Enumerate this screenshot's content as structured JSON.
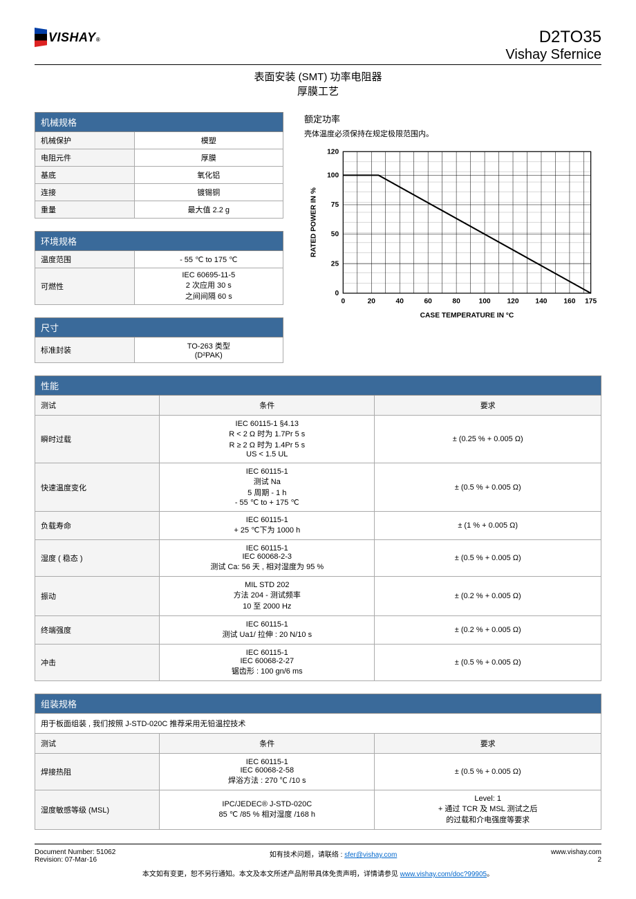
{
  "header": {
    "logo_text": "VISHAY",
    "logo_mark": "®",
    "product_code": "D2TO35",
    "brand": "Vishay Sfernice",
    "title_line1": "表面安装 (SMT) 功率电阻器",
    "title_line2": "厚膜工艺"
  },
  "mech": {
    "title": "机械规格",
    "rows": [
      {
        "label": "机械保护",
        "value": "模塑"
      },
      {
        "label": "电阻元件",
        "value": "厚膜"
      },
      {
        "label": "基底",
        "value": "氧化铝"
      },
      {
        "label": "连接",
        "value": "镀锡铜"
      },
      {
        "label": "重量",
        "value": "最大值 2.2 g"
      }
    ]
  },
  "env": {
    "title": "环境规格",
    "rows": [
      {
        "label": "温度范围",
        "value": "- 55 ℃ to 175 ℃"
      },
      {
        "label": "可燃性",
        "value": "IEC 60695-11-5\n2 次应用 30 s\n之间间隔 60 s"
      }
    ]
  },
  "dim": {
    "title": "尺寸",
    "rows": [
      {
        "label": "标准封装",
        "value": "TO-263 类型\n(D²PAK)"
      }
    ]
  },
  "power": {
    "title": "额定功率",
    "sub": "壳体温度必须保持在规定极限范围内。"
  },
  "chart_data": {
    "type": "line",
    "xlabel": "CASE TEMPERATURE IN °C",
    "ylabel": "RATED POWER IN %",
    "xlim": [
      0,
      175
    ],
    "ylim": [
      0,
      120
    ],
    "xticks": [
      0,
      20,
      40,
      60,
      80,
      100,
      120,
      140,
      160,
      175
    ],
    "yticks": [
      0,
      25,
      50,
      75,
      100,
      120
    ],
    "series": [
      {
        "name": "derating",
        "x": [
          0,
          25,
          175
        ],
        "y": [
          100,
          100,
          0
        ]
      }
    ]
  },
  "perf": {
    "title": "性能",
    "cols": [
      "测试",
      "条件",
      "要求"
    ],
    "rows": [
      {
        "test": "瞬时过载",
        "cond": "IEC 60115-1 §4.13\nR < 2 Ω 时为 1.7Pr 5 s\nR ≥ 2 Ω 时为 1.4Pr 5 s\nUS < 1.5 UL",
        "req": "± (0.25 % + 0.005 Ω)"
      },
      {
        "test": "快速温度变化",
        "cond": "IEC 60115-1\n测试 Na\n5 周期 - 1 h\n- 55 ℃ to + 175 ℃",
        "req": "± (0.5 % + 0.005 Ω)"
      },
      {
        "test": "负载寿命",
        "cond": "IEC 60115-1\n+ 25 ℃下为 1000 h",
        "req": "± (1 % + 0.005 Ω)"
      },
      {
        "test": "湿度 ( 稳态 )",
        "cond": "IEC 60115-1\nIEC 60068-2-3\n测试 Ca: 56 天 , 相对湿度为 95 %",
        "req": "± (0.5 % + 0.005 Ω)"
      },
      {
        "test": "振动",
        "cond": "MIL STD 202\n方法 204 - 测试频率\n10 至 2000 Hz",
        "req": "± (0.2 % + 0.005 Ω)"
      },
      {
        "test": "终端强度",
        "cond": "IEC 60115-1\n测试 Ua1/ 拉伸 : 20 N/10 s",
        "req": "± (0.2 % + 0.005 Ω)"
      },
      {
        "test": "冲击",
        "cond": "IEC 60115-1\nIEC 60068-2-27\n锯齿形 : 100 gn/6 ms",
        "req": "± (0.5 % + 0.005 Ω)"
      }
    ]
  },
  "assembly": {
    "title": "组装规格",
    "note": "用于板面组装 , 我们按照 J-STD-020C 推荐采用无铅温控技术",
    "cols": [
      "测试",
      "条件",
      "要求"
    ],
    "rows": [
      {
        "test": "焊接热阻",
        "cond": "IEC 60115-1\nIEC 60068-2-58\n焊浴方法 : 270 ℃ /10 s",
        "req": "± (0.5 % + 0.005 Ω)"
      },
      {
        "test": "湿度敏感等级 (MSL)",
        "cond": "IPC/JEDEC® J-STD-020C\n85 ℃ /85 % 相对湿度 /168 h",
        "req": "Level: 1\n+ 通过 TCR 及 MSL 测试之后\n的过载和介电强度等要求"
      }
    ]
  },
  "footer": {
    "docnum_label": "Document Number:",
    "docnum": "51062",
    "rev_label": "Revision:",
    "rev": "07-Mar-16",
    "contact_prefix": "如有技术问题，请联络 :",
    "contact_email": "sfer@vishay.com",
    "site": "www.vishay.com",
    "page": "2",
    "disclaimer_prefix": "本文如有变更，恕不另行通知。本文及本文所述产品附带具体免责声明，详情请参见",
    "disclaimer_link": "www.vishay.com/doc?99905",
    "disclaimer_suffix": "。"
  }
}
